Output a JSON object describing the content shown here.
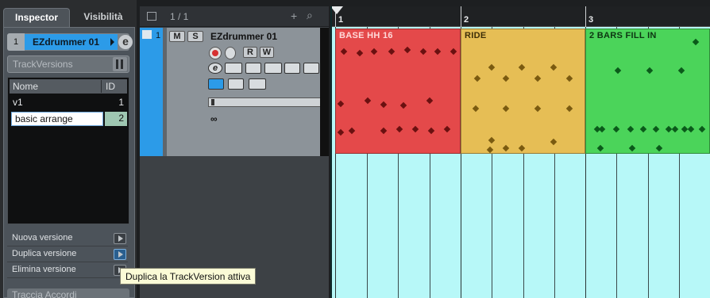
{
  "inspector": {
    "tabs": [
      {
        "label": "Inspector"
      },
      {
        "label": "Visibilità"
      }
    ],
    "track": {
      "number": "1",
      "name": "EZdrummer 01",
      "edit_icon": "e"
    },
    "trackversions": {
      "label": "TrackVersions"
    },
    "versions_table": {
      "headers": {
        "name": "Nome",
        "id": "ID"
      },
      "rows": [
        {
          "name": "v1",
          "id": "1"
        },
        {
          "name": "basic arrange",
          "id": "2"
        }
      ]
    },
    "actions": [
      {
        "label": "Nuova versione"
      },
      {
        "label": "Duplica versione"
      },
      {
        "label": "Elimina versione"
      }
    ],
    "accordi_label": "Traccia Accordi",
    "tooltip": "Duplica la TrackVersion attiva"
  },
  "tracklist": {
    "page": "1 / 1",
    "plus": "+",
    "find": "⌕",
    "track": {
      "index": "1",
      "name": "EZdrummer 01",
      "mute": "M",
      "solo": "S",
      "read": "R",
      "write": "W",
      "edit": "e",
      "routing": "∞"
    }
  },
  "arranger": {
    "bars": [
      {
        "label": "1"
      },
      {
        "label": "2"
      },
      {
        "label": "3"
      }
    ],
    "parts": [
      {
        "name": "BASE HH 16",
        "color": "#e4494a",
        "title_color": "#ffd9d9"
      },
      {
        "name": "RIDE",
        "color": "#e6be55",
        "title_color": "#3e2f08"
      },
      {
        "name": "2 BARS FILL IN",
        "color": "#4bd45a",
        "title_color": "#0d3512"
      }
    ],
    "lane_color": "#b7f8f8"
  }
}
